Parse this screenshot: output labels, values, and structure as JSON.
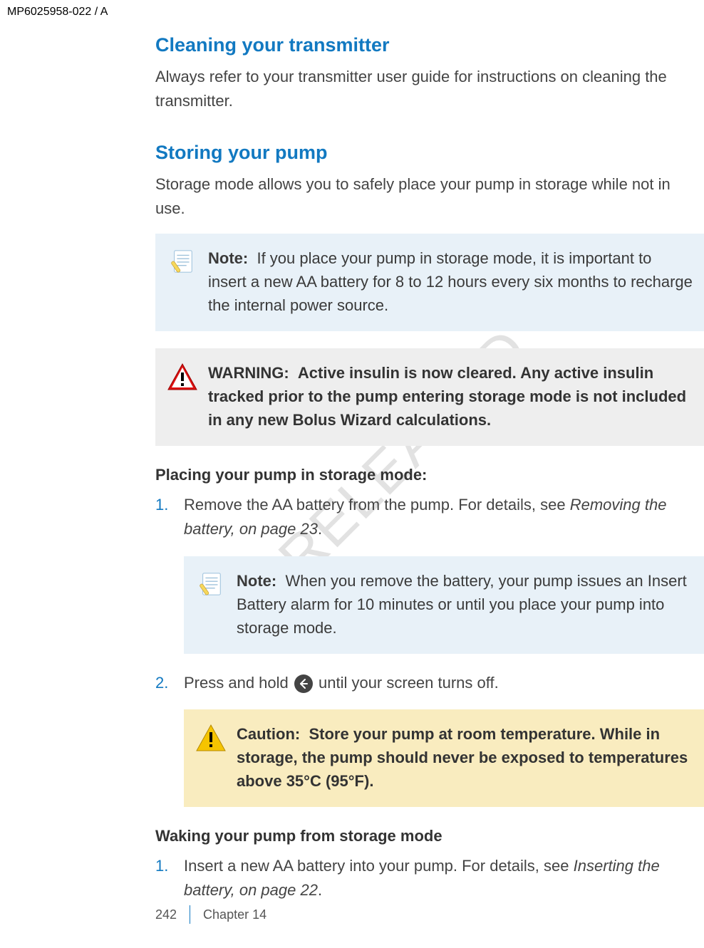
{
  "docId": "MP6025958-022 / A",
  "watermark": "RELEASED",
  "section1": {
    "title": "Cleaning your transmitter",
    "body": "Always refer to your transmitter user guide for instructions on cleaning the transmitter."
  },
  "section2": {
    "title": "Storing your pump",
    "body": "Storage mode allows you to safely place your pump in storage while not in use.",
    "note1": {
      "lead": "Note:",
      "text": "If you place your pump in storage mode, it is important to insert a new AA battery for 8 to 12 hours every six months to recharge the internal power source."
    },
    "warning": {
      "lead": "WARNING:",
      "text": "Active insulin is now cleared. Any active insulin tracked prior to the pump entering storage mode is not included in any new Bolus Wizard calculations."
    },
    "sub1_title": "Placing your pump in storage mode:",
    "step1a": "Remove the AA battery from the pump. For details, see ",
    "step1b_ref": "Removing the battery, on page 23",
    "step1c": ".",
    "note2": {
      "lead": "Note:",
      "text": "When you remove the battery, your pump issues an Insert Battery alarm for 10 minutes or until you place your pump into storage mode."
    },
    "step2a": "Press and hold ",
    "step2b": " until your screen turns off.",
    "caution": {
      "lead": "Caution:",
      "text": "Store your pump at room temperature. While in storage, the pump should never be exposed to temperatures above 35°C (95°F)."
    },
    "sub2_title": "Waking your pump from storage mode",
    "wake_step1a": "Insert a new AA battery into your pump. For details, see ",
    "wake_step1b_ref": "Inserting the battery, on page 22",
    "wake_step1c": "."
  },
  "footer": {
    "page": "242",
    "chapter": "Chapter 14"
  }
}
